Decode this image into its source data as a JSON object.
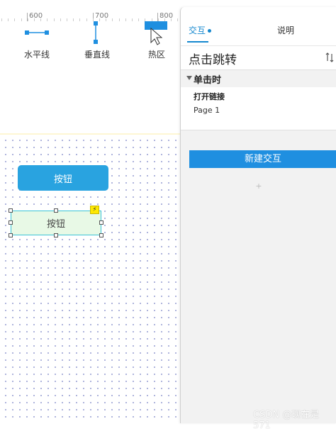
{
  "ruler": {
    "ticks": [
      "600",
      "700",
      "800"
    ]
  },
  "widget_library": {
    "items": [
      {
        "label": "水平线",
        "icon": "horizontal-line-icon"
      },
      {
        "label": "垂直线",
        "icon": "vertical-line-icon"
      },
      {
        "label": "热区",
        "icon": "hotspot-icon"
      }
    ]
  },
  "canvas": {
    "primary_button_label": "按钮",
    "selected_button_label": "按钮",
    "interaction_badge": "⚡"
  },
  "panel": {
    "tabs": [
      {
        "label": "交互",
        "active": true
      },
      {
        "label": "说明",
        "active": false
      }
    ],
    "interaction_name": "点击跳转",
    "event": {
      "label": "单击时",
      "actions": [
        {
          "label": "打开链接",
          "target": "Page 1"
        }
      ]
    },
    "add_action_symbol": "+",
    "new_interaction_label": "新建交互"
  },
  "watermark": "CSDN @现在是571",
  "colors": {
    "accent": "#1588cf",
    "button_blue": "#29a3e0",
    "selected_fill": "#e8f9e6",
    "selection_border": "#39c3d6"
  }
}
